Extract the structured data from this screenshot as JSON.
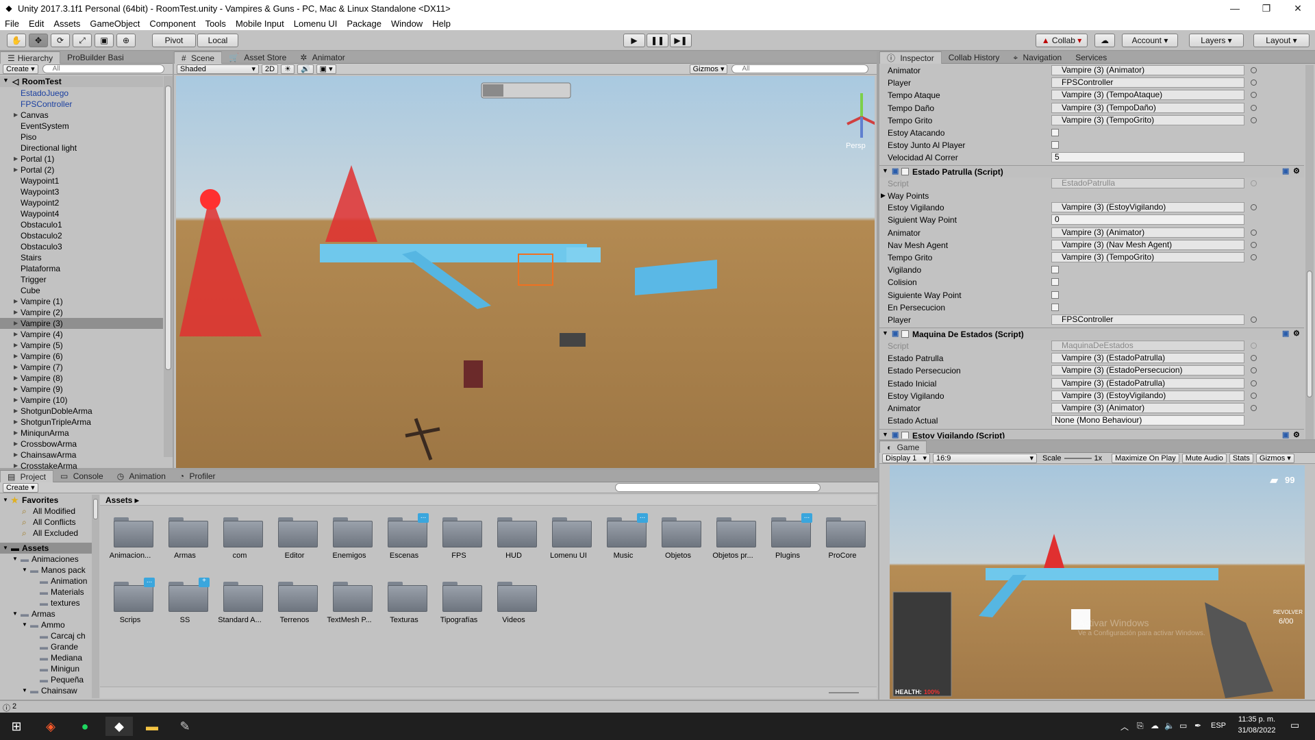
{
  "window": {
    "title": "Unity 2017.3.1f1 Personal (64bit) - RoomTest.unity - Vampires & Guns - PC, Mac & Linux Standalone <DX11>"
  },
  "menu": [
    "File",
    "Edit",
    "Assets",
    "GameObject",
    "Component",
    "Tools",
    "Mobile Input",
    "Lomenu UI",
    "Package",
    "Window",
    "Help"
  ],
  "toolbar": {
    "pivot": "Pivot",
    "local": "Local",
    "collab": "Collab",
    "account": "Account",
    "layers": "Layers",
    "layout": "Layout"
  },
  "hierarchy": {
    "tabs": [
      "Hierarchy",
      "ProBuilder Basi"
    ],
    "create": "Create",
    "search_placeholder": "All",
    "scene": "RoomTest",
    "items": [
      {
        "label": "EstadoJuego",
        "arrow": "",
        "blue": true
      },
      {
        "label": "FPSController",
        "arrow": "",
        "blue": true
      },
      {
        "label": "Canvas",
        "arrow": "▶"
      },
      {
        "label": "EventSystem",
        "arrow": ""
      },
      {
        "label": "Piso",
        "arrow": ""
      },
      {
        "label": "Directional light",
        "arrow": ""
      },
      {
        "label": "Portal (1)",
        "arrow": "▶"
      },
      {
        "label": "Portal (2)",
        "arrow": "▶"
      },
      {
        "label": "Waypoint1",
        "arrow": ""
      },
      {
        "label": "Waypoint3",
        "arrow": ""
      },
      {
        "label": "Waypoint2",
        "arrow": ""
      },
      {
        "label": "Waypoint4",
        "arrow": ""
      },
      {
        "label": "Obstaculo1",
        "arrow": ""
      },
      {
        "label": "Obstaculo2",
        "arrow": ""
      },
      {
        "label": "Obstaculo3",
        "arrow": ""
      },
      {
        "label": "Stairs",
        "arrow": ""
      },
      {
        "label": "Plataforma",
        "arrow": ""
      },
      {
        "label": "Trigger",
        "arrow": ""
      },
      {
        "label": "Cube",
        "arrow": ""
      },
      {
        "label": "Vampire (1)",
        "arrow": "▶"
      },
      {
        "label": "Vampire (2)",
        "arrow": "▶"
      },
      {
        "label": "Vampire (3)",
        "arrow": "▶",
        "selected": true
      },
      {
        "label": "Vampire (4)",
        "arrow": "▶"
      },
      {
        "label": "Vampire (5)",
        "arrow": "▶"
      },
      {
        "label": "Vampire (6)",
        "arrow": "▶"
      },
      {
        "label": "Vampire (7)",
        "arrow": "▶"
      },
      {
        "label": "Vampire (8)",
        "arrow": "▶"
      },
      {
        "label": "Vampire (9)",
        "arrow": "▶"
      },
      {
        "label": "Vampire (10)",
        "arrow": "▶"
      },
      {
        "label": "ShotgunDobleArma",
        "arrow": "▶"
      },
      {
        "label": "ShotgunTripleArma",
        "arrow": "▶"
      },
      {
        "label": "MiniqunArma",
        "arrow": "▶"
      },
      {
        "label": "CrossbowArma",
        "arrow": "▶"
      },
      {
        "label": "ChainsawArma",
        "arrow": "▶"
      },
      {
        "label": "CrosstakeArma",
        "arrow": "▶"
      }
    ]
  },
  "scene": {
    "tabs": [
      "Scene",
      "Asset Store",
      "Animator"
    ],
    "shaded": "Shaded",
    "mode2d": "2D",
    "gizmos": "Gizmos",
    "search_placeholder": "All",
    "persp": "Persp"
  },
  "inspector": {
    "tabs": [
      "Inspector",
      "Collab History",
      "Navigation",
      "Services"
    ],
    "top_rows": [
      {
        "k": "Animator",
        "v": "Vampire (3) (Animator)"
      },
      {
        "k": "Player",
        "v": "FPSController"
      },
      {
        "k": "Tempo Ataque",
        "v": "Vampire (3) (TempoAtaque)"
      },
      {
        "k": "Tempo Daño",
        "v": "Vampire (3) (TempoDaño)"
      },
      {
        "k": "Tempo Grito",
        "v": "Vampire (3) (TempoGrito)"
      },
      {
        "k": "Estoy Atacando",
        "check": true
      },
      {
        "k": "Estoy Junto Al Player",
        "check": true
      },
      {
        "k": "Velocidad Al Correr",
        "v": "5",
        "plain": true
      }
    ],
    "comp1": {
      "title": "Estado Patrulla (Script)",
      "script": "EstadoPatrulla",
      "waypoints": "Way Points",
      "rows": [
        {
          "k": "Estoy Vigilando",
          "v": "Vampire (3) (EstoyVigilando)"
        },
        {
          "k": "Siguient Way Point",
          "v": "0",
          "plain": true
        },
        {
          "k": "Animator",
          "v": "Vampire (3) (Animator)"
        },
        {
          "k": "Nav Mesh Agent",
          "v": "Vampire (3) (Nav Mesh Agent)"
        },
        {
          "k": "Tempo Grito",
          "v": "Vampire (3) (TempoGrito)"
        },
        {
          "k": "Vigilando",
          "check": true
        },
        {
          "k": "Colision",
          "check": true
        },
        {
          "k": "Siguiente Way Point",
          "check": true
        },
        {
          "k": "En Persecucion",
          "check": true
        },
        {
          "k": "Player",
          "v": "FPSController"
        }
      ]
    },
    "comp2": {
      "title": "Maquina De Estados (Script)",
      "script": "MaquinaDeEstados",
      "rows": [
        {
          "k": "Estado Patrulla",
          "v": "Vampire (3) (EstadoPatrulla)"
        },
        {
          "k": "Estado Persecucion",
          "v": "Vampire (3) (EstadoPersecucion)"
        },
        {
          "k": "Estado Inicial",
          "v": "Vampire (3) (EstadoPatrulla)"
        },
        {
          "k": "Estoy Vigilando",
          "v": "Vampire (3) (EstoyVigilando)"
        },
        {
          "k": "Animator",
          "v": "Vampire (3) (Animator)"
        },
        {
          "k": "Estado Actual",
          "v": "None (Mono Behaviour)",
          "plain": true
        }
      ]
    },
    "comp3": {
      "title": "Estoy Vigilando (Script)"
    },
    "script_label": "Script"
  },
  "game": {
    "tab": "Game",
    "display": "Display 1",
    "aspect": "16:9",
    "scale": "Scale",
    "scale_val": "1x",
    "maximize": "Maximize On Play",
    "mute": "Mute Audio",
    "stats": "Stats",
    "gizmos": "Gizmos",
    "ammo": "99",
    "health": "HEALTH:",
    "health_val": "100%",
    "weapon": "REVOLVER",
    "clip": "6/00",
    "watermark1": "Activar Windows",
    "watermark2": "Ve a Configuración para activar Windows."
  },
  "project": {
    "tabs": [
      "Project",
      "Console",
      "Animation",
      "Profiler"
    ],
    "create": "Create",
    "favorites": "Favorites",
    "fav_items": [
      "All Modified",
      "All Conflicts",
      "All Excluded"
    ],
    "assets_root": "Assets",
    "breadcrumb": "Assets",
    "tree": [
      {
        "label": "Animaciones",
        "lvl": 1,
        "arrow": "▼"
      },
      {
        "label": "Manos pack",
        "lvl": 2,
        "arrow": "▼"
      },
      {
        "label": "Animation",
        "lvl": 3,
        "arrow": ""
      },
      {
        "label": "Materials",
        "lvl": 3,
        "arrow": ""
      },
      {
        "label": "textures",
        "lvl": 3,
        "arrow": ""
      },
      {
        "label": "Armas",
        "lvl": 1,
        "arrow": "▼"
      },
      {
        "label": "Ammo",
        "lvl": 2,
        "arrow": "▼"
      },
      {
        "label": "Carcaj ch",
        "lvl": 3,
        "arrow": ""
      },
      {
        "label": "Grande",
        "lvl": 3,
        "arrow": ""
      },
      {
        "label": "Mediana",
        "lvl": 3,
        "arrow": ""
      },
      {
        "label": "Minigun",
        "lvl": 3,
        "arrow": ""
      },
      {
        "label": "Pequeña",
        "lvl": 3,
        "arrow": ""
      },
      {
        "label": "Chainsaw",
        "lvl": 2,
        "arrow": "▼"
      }
    ],
    "folders": [
      {
        "label": "Animacion...",
        "badge": ""
      },
      {
        "label": "Armas",
        "badge": ""
      },
      {
        "label": "com",
        "badge": ""
      },
      {
        "label": "Editor",
        "badge": ""
      },
      {
        "label": "Enemigos",
        "badge": ""
      },
      {
        "label": "Escenas",
        "badge": "..."
      },
      {
        "label": "FPS",
        "badge": ""
      },
      {
        "label": "HUD",
        "badge": ""
      },
      {
        "label": "Lomenu UI",
        "badge": ""
      },
      {
        "label": "Music",
        "badge": "..."
      },
      {
        "label": "Objetos",
        "badge": ""
      },
      {
        "label": "Objetos pr...",
        "badge": ""
      },
      {
        "label": "Plugins",
        "badge": "..."
      },
      {
        "label": "ProCore",
        "badge": ""
      },
      {
        "label": "Scrips",
        "badge": "..."
      },
      {
        "label": "SS",
        "badge": "+"
      },
      {
        "label": "Standard A...",
        "badge": ""
      },
      {
        "label": "Terrenos",
        "badge": ""
      },
      {
        "label": "TextMesh P...",
        "badge": ""
      },
      {
        "label": "Texturas",
        "badge": ""
      },
      {
        "label": "Tipografías",
        "badge": ""
      },
      {
        "label": "Videos",
        "badge": ""
      }
    ],
    "status_count": "2"
  },
  "taskbar": {
    "lang": "ESP",
    "time": "11:35 p. m.",
    "date": "31/08/2022"
  }
}
